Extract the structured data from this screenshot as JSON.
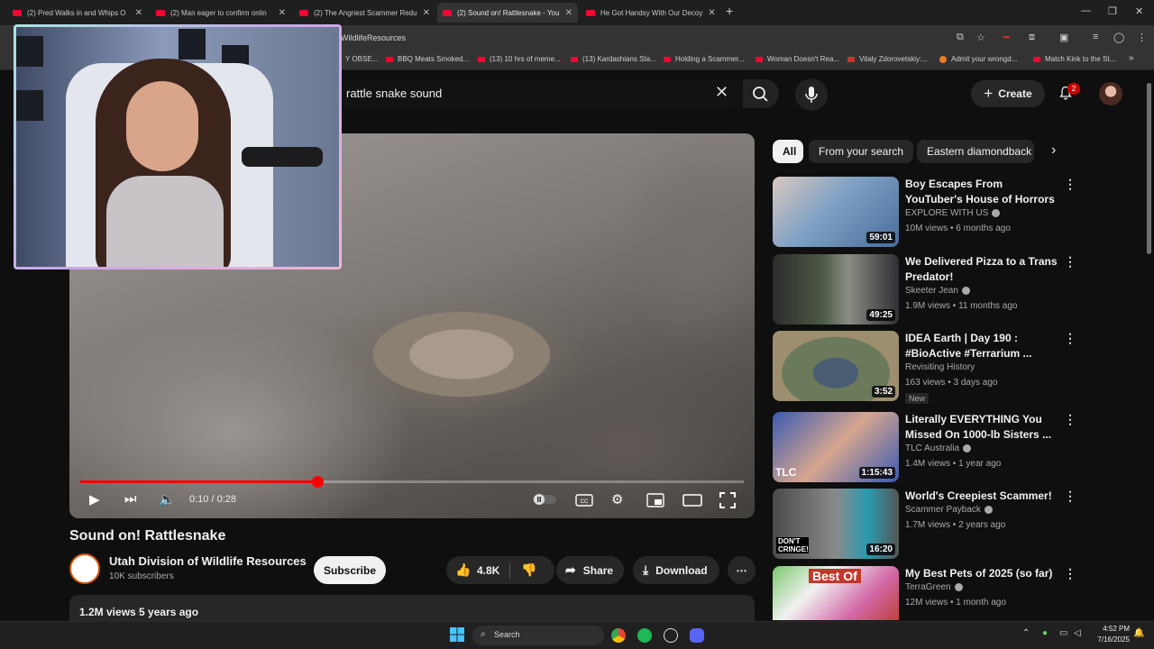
{
  "browser": {
    "tabs": [
      {
        "title": "(2) Pred Walks in and Whips O"
      },
      {
        "title": "(2) Man eager to confirm onlin"
      },
      {
        "title": "(2) The Angriest Scammer Redu"
      },
      {
        "title": "(2) Sound on! Rattlesnake - You",
        "active": true
      },
      {
        "title": "He Got Handsy With Our Decoy"
      }
    ],
    "new_tab": "+",
    "address": "WildlifeResources",
    "bookmarks": [
      "Y OBSE...",
      "BBQ Meats Smoked...",
      "(13) 10 hrs of meme...",
      "(13) Kardashians Sta...",
      "Holding a Scammer...",
      "Woman Doesn't Rea...",
      "Vitaly Zdorovetskiy:...",
      "Admit your wrongd...",
      "Match Kink to the St..."
    ],
    "bookmark_more": "»"
  },
  "header": {
    "search_query": "rattle snake sound",
    "create_label": "Create",
    "notification_count": "2"
  },
  "player": {
    "time_text": "0:10 / 0:28",
    "progress_fraction": 0.357
  },
  "video": {
    "title": "Sound on! Rattlesnake",
    "channel_name": "Utah Division of Wildlife Resources",
    "subscribers": "10K subscribers",
    "subscribe_label": "Subscribe",
    "likes": "4.8K",
    "share_label": "Share",
    "download_label": "Download",
    "views_line": "1.2M views  5 years ago"
  },
  "chips": [
    "All",
    "From your search",
    "Eastern diamondback"
  ],
  "recommendations": [
    {
      "title": "Boy Escapes From YouTuber's House of Horrors",
      "channel": "EXPLORE WITH US",
      "verified": true,
      "meta": "10M views • 6 months ago",
      "duration": "59:01",
      "is_new": false,
      "thumb_color": "#7ea0c4"
    },
    {
      "title": "We Delivered Pizza to a Trans Predator!",
      "channel": "Skeeter Jean",
      "verified": true,
      "meta": "1.9M views • 11 months ago",
      "duration": "49:25",
      "is_new": false,
      "thumb_color": "#3c4a3a"
    },
    {
      "title": "IDEA Earth | Day 190 : #BioActive #Terrarium ...",
      "channel": "Revisiting History",
      "verified": false,
      "meta": "163 views • 3 days ago",
      "duration": "3:52",
      "is_new": true,
      "new_label": "New",
      "thumb_color": "#6b7a5a"
    },
    {
      "title": "Literally EVERYTHING You Missed On 1000-lb Sisters ...",
      "channel": "TLC Australia",
      "verified": true,
      "meta": "1.4M views • 1 year ago",
      "duration": "1:15:43",
      "is_new": false,
      "thumb_color": "#3a5ab0"
    },
    {
      "title": "World's Creepiest Scammer!",
      "channel": "Scammer Payback",
      "verified": true,
      "meta": "1.7M views • 2 years ago",
      "duration": "16:20",
      "is_new": false,
      "thumb_color": "#6a6a6a"
    },
    {
      "title": "My Best Pets of 2025 (so far)",
      "channel": "TerraGreen",
      "verified": true,
      "meta": "12M views • 1 month ago",
      "duration": "",
      "is_new": false,
      "thumb_color": "#d36aa8"
    }
  ],
  "thumb_texts": {
    "tlc": "TLC",
    "dont_cringe": "DON'T CRINGE!",
    "best_of": "Best Of"
  },
  "taskbar": {
    "search_label": "Search",
    "time": "4:52 PM",
    "date": "7/16/2025"
  },
  "colors": {
    "accent": "#ff0000",
    "background": "#0f0f0f",
    "surface": "#272727"
  }
}
